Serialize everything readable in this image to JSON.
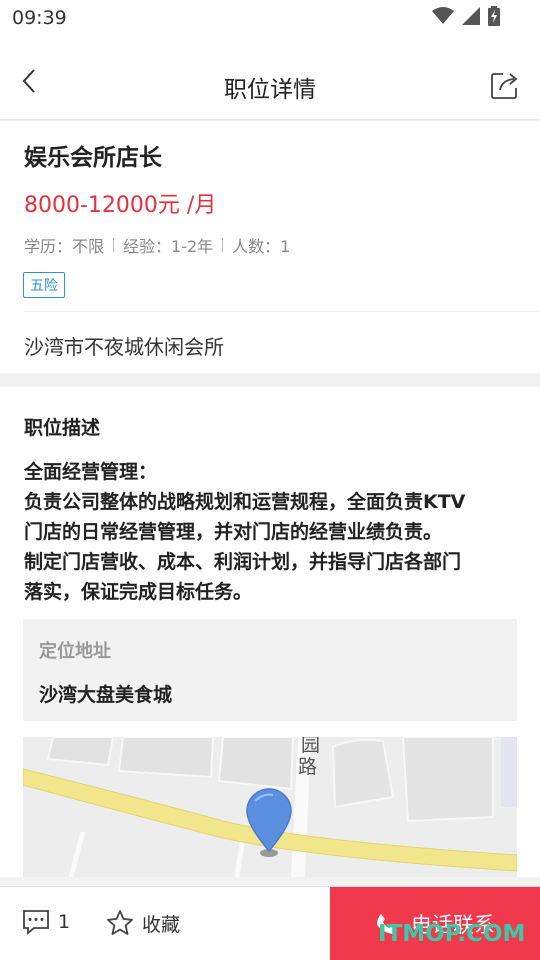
{
  "status_bar": {
    "time": "09:39",
    "icons": [
      "wifi-icon",
      "cellular-signal-icon",
      "battery-charging-icon"
    ]
  },
  "nav": {
    "title": "职位详情",
    "back_icon": "chevron-left-icon",
    "share_icon": "share-icon"
  },
  "job": {
    "title": "娱乐会所店长",
    "salary": "8000-12000元 /月",
    "meta": [
      "学历：不限",
      "经验：1-2年",
      "人数：1"
    ],
    "tags": [
      "五险"
    ],
    "company": "沙湾市不夜城休闲会所"
  },
  "description": {
    "section_title": "职位描述",
    "lines": [
      "全面经营管理：",
      "负责公司整体的战略规划和运营规程，全面负责KTV",
      "门店的日常经营管理，并对门店的经营业绩负责。",
      "制定门店营收、成本、利润计划，并指导门店各部门",
      "落实，保证完成目标任务。"
    ]
  },
  "location": {
    "label": "定位地址",
    "value": "沙湾大盘美食城"
  },
  "map": {
    "road_label_1": "园",
    "road_label_2": "路",
    "marker_icon": "map-pin-icon",
    "road_color": "#f2e68c",
    "pin_color": "#5b8fe0"
  },
  "bottom_bar": {
    "comment_count": "1",
    "favorite_label": "收藏",
    "call_label": "电话联系",
    "accent_color": "#f0394d"
  },
  "watermark": "ITMOP.COM"
}
